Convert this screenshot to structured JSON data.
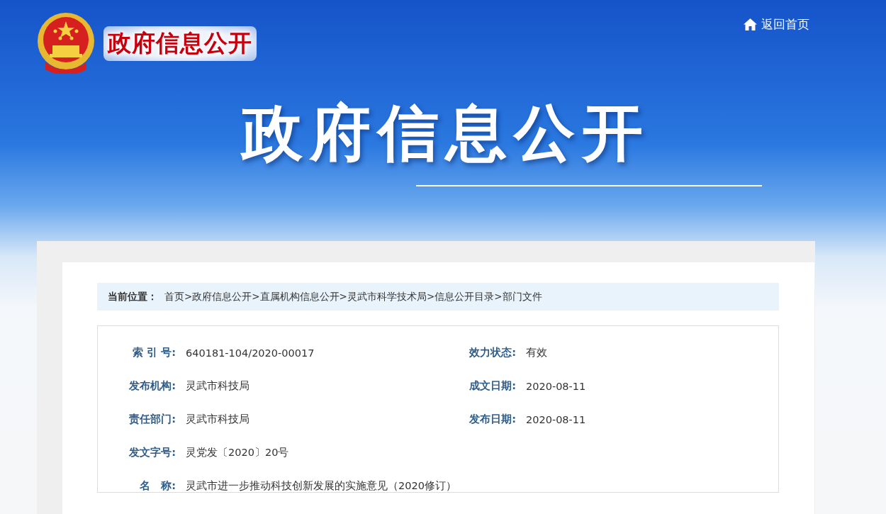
{
  "header": {
    "logo_text": "政府信息公开",
    "home_link": "返回首页",
    "banner_title": "政府信息公开"
  },
  "breadcrumb": {
    "label": "当前位置：",
    "trail": "首页>政府信息公开>直属机构信息公开>灵武市科学技术局>信息公开目录>部门文件"
  },
  "info_rows": [
    {
      "fields": [
        {
          "label": "索 引 号:",
          "value": "640181-104/2020-00017"
        },
        {
          "label": "效力状态:",
          "value": "有效"
        }
      ]
    },
    {
      "fields": [
        {
          "label": "发布机构:",
          "value": "灵武市科技局"
        },
        {
          "label": "成文日期:",
          "value": "2020-08-11"
        }
      ]
    },
    {
      "fields": [
        {
          "label": "责任部门:",
          "value": "灵武市科技局"
        },
        {
          "label": "发布日期:",
          "value": "2020-08-11"
        }
      ]
    },
    {
      "fields": [
        {
          "label": "发文字号:",
          "value": "灵党发〔2020〕20号"
        }
      ]
    },
    {
      "fields": [
        {
          "label": "名　称:",
          "value": "灵武市进一步推动科技创新发展的实施意见（2020修订）"
        }
      ]
    }
  ]
}
